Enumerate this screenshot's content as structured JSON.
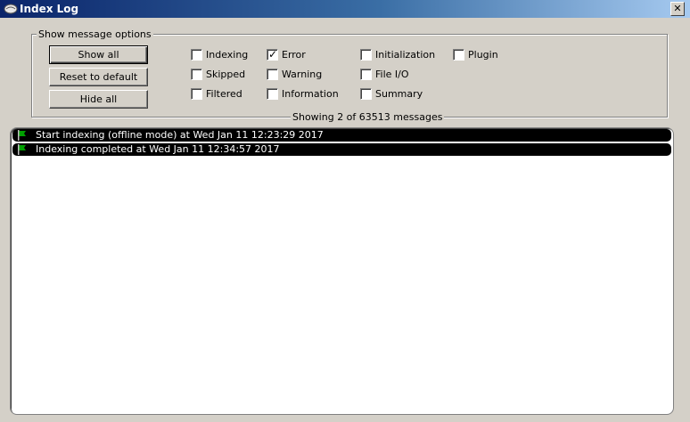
{
  "window": {
    "title": "Index Log",
    "close_glyph": "✕"
  },
  "options": {
    "group_title": "Show message options",
    "buttons": {
      "show_all": "Show all",
      "reset_default": "Reset to default",
      "hide_all": "Hide all"
    },
    "checkboxes": [
      {
        "label": "Indexing",
        "checked": false
      },
      {
        "label": "Skipped",
        "checked": false
      },
      {
        "label": "Filtered",
        "checked": false
      },
      {
        "label": "Error",
        "checked": true
      },
      {
        "label": "Warning",
        "checked": false
      },
      {
        "label": "Information",
        "checked": false
      },
      {
        "label": "Initialization",
        "checked": false
      },
      {
        "label": "File I/O",
        "checked": false
      },
      {
        "label": "Summary",
        "checked": false
      },
      {
        "label": "Plugin",
        "checked": false
      }
    ],
    "check_glyph": "✓"
  },
  "status": {
    "text": "Showing 2 of 63513 messages"
  },
  "log": {
    "entries": [
      {
        "icon": "green-flag-icon",
        "message": "Start indexing (offline mode) at Wed Jan 11 12:23:29 2017"
      },
      {
        "icon": "green-flag-icon",
        "message": "Indexing completed at Wed Jan 11 12:34:57 2017"
      }
    ]
  },
  "colors": {
    "flag": "#00a000",
    "titlebar_start": "#0a246a",
    "titlebar_end": "#a6caf0"
  }
}
